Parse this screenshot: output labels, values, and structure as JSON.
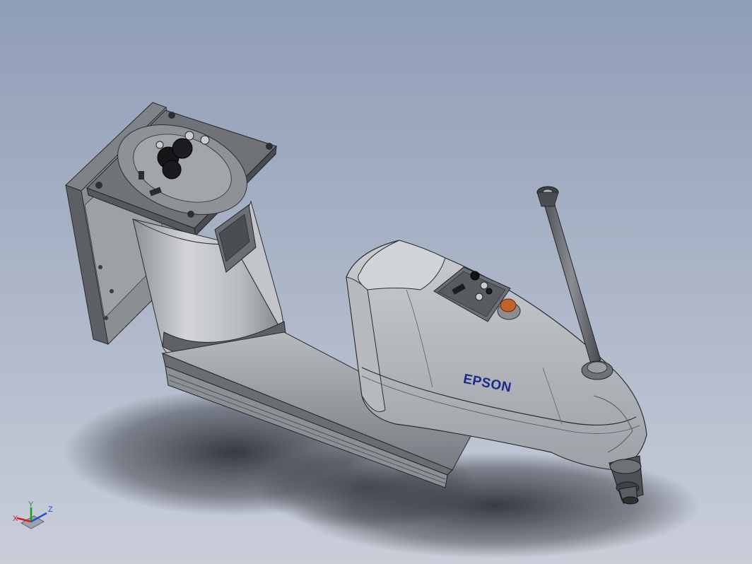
{
  "model": {
    "brand_label": "EPSON"
  },
  "triad": {
    "x_label": "X",
    "y_label": "Y",
    "z_label": "Z",
    "x_color": "#d42020",
    "y_color": "#1c9b1c",
    "z_color": "#2050d0"
  },
  "colors": {
    "background_top": "#8f9db6",
    "background_bottom": "#c9ced9",
    "body_light": "#c8cbd0",
    "body_mid": "#a9acb2",
    "body_dark": "#6e7176",
    "plate_dark": "#55585d",
    "emergency_button": "#c0622a",
    "brand_text": "#1c2a8c"
  }
}
